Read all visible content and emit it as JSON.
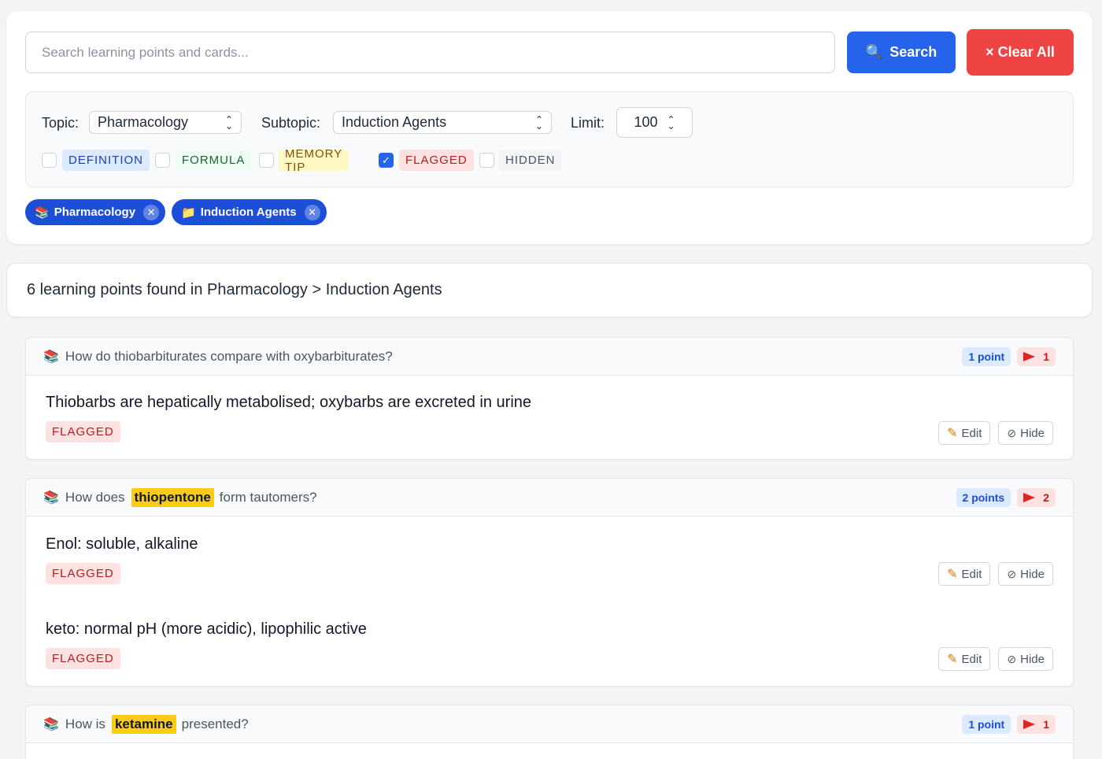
{
  "search": {
    "placeholder": "Search learning points and cards...",
    "search_label": "Search",
    "search_icon": "🔍",
    "clear_label": "× Clear All"
  },
  "filters": {
    "topic_label": "Topic:",
    "topic_value": "Pharmacology",
    "subtopic_label": "Subtopic:",
    "subtopic_value": "Induction Agents",
    "limit_label": "Limit:",
    "limit_value": "100",
    "types": [
      {
        "label": "DEFINITION",
        "checked": false
      },
      {
        "label": "FORMULA",
        "checked": false
      },
      {
        "label": "MEMORY TIP",
        "checked": false
      },
      {
        "label": "FLAGGED",
        "checked": true
      },
      {
        "label": "HIDDEN",
        "checked": false
      }
    ]
  },
  "chips": [
    {
      "icon": "📚",
      "label": "Pharmacology"
    },
    {
      "icon": "📁",
      "label": "Induction Agents"
    }
  ],
  "results": {
    "summary": "6 learning points found in Pharmacology > Induction Agents"
  },
  "cards": [
    {
      "q_pre": "How do thiobarbiturates compare with oxybarbiturates?",
      "q_hl": "",
      "q_post": "",
      "points_label": "1 point",
      "flag_count": "1",
      "points": [
        {
          "text": "Thiobarbs are hepatically metabolised; oxybarbs are excreted in urine",
          "tag": "FLAGGED"
        }
      ]
    },
    {
      "q_pre": "How does",
      "q_hl": "thiopentone",
      "q_post": "form tautomers?",
      "points_label": "2 points",
      "flag_count": "2",
      "points": [
        {
          "text": "Enol: soluble, alkaline",
          "tag": "FLAGGED"
        },
        {
          "text": "keto: normal pH (more acidic), lipophilic active",
          "tag": "FLAGGED"
        }
      ]
    },
    {
      "q_pre": "How is",
      "q_hl": "ketamine",
      "q_post": "presented?",
      "points_label": "1 point",
      "flag_count": "1",
      "points": []
    }
  ],
  "actions": {
    "edit_label": "Edit",
    "hide_label": "Hide"
  },
  "colors": {
    "primary": "#2563eb",
    "danger": "#ef4444",
    "highlight": "#facc15",
    "flag": "#dc2626"
  }
}
